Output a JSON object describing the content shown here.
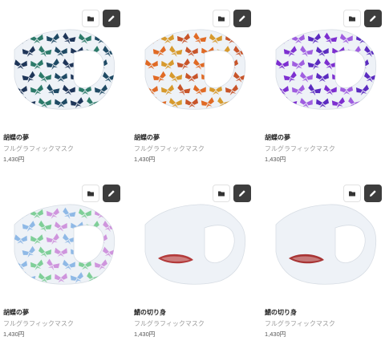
{
  "products": [
    {
      "title": "胡蝶の夢",
      "type": "フルグラフィックマスク",
      "price": "1,430円",
      "design": "butterflies",
      "colors": [
        "#1e3558",
        "#2c7a69",
        "#1f4a64"
      ]
    },
    {
      "title": "胡蝶の夢",
      "type": "フルグラフィックマスク",
      "price": "1,430円",
      "design": "butterflies",
      "colors": [
        "#e06a25",
        "#d79a2d",
        "#c8552a"
      ]
    },
    {
      "title": "胡蝶の夢",
      "type": "フルグラフィックマスク",
      "price": "1,430円",
      "design": "butterflies",
      "colors": [
        "#7d2fd0",
        "#a05ee0",
        "#5b2bc0"
      ]
    },
    {
      "title": "胡蝶の夢",
      "type": "フルグラフィックマスク",
      "price": "1,430円",
      "design": "butterflies",
      "colors": [
        "#8fb9e6",
        "#7fcf98",
        "#cf95dd"
      ]
    },
    {
      "title": "鯖の切り身",
      "type": "フルグラフィックマスク",
      "price": "1,430円",
      "design": "fish-slice",
      "colors": [
        "#b33a3a",
        "#e5e9ee"
      ]
    },
    {
      "title": "鯖の切り身",
      "type": "フルグラフィックマスク",
      "price": "1,430円",
      "design": "fish-slice",
      "colors": [
        "#a83434",
        "#e5e9ee"
      ]
    }
  ],
  "icons": {
    "folder": "folder-icon",
    "edit": "pencil-icon"
  },
  "theme": {
    "mask_bg": "#eef2f7",
    "edit_button_bg": "#3d3d3d"
  }
}
